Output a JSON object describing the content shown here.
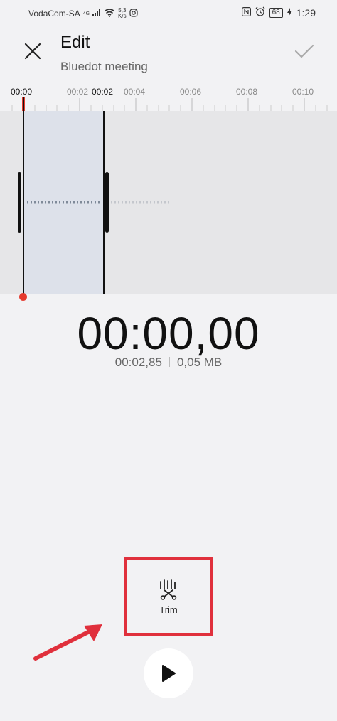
{
  "status_bar": {
    "carrier": "VodaCom-SA",
    "network": "4G",
    "speed_value": "5,3",
    "speed_unit": "K/s",
    "battery": "68",
    "time": "1:29"
  },
  "header": {
    "title": "Edit",
    "subtitle": "Bluedot meeting"
  },
  "ruler": {
    "labels": [
      "00:00",
      "00:02",
      "00:02",
      "00:04",
      "00:06",
      "00:08",
      "00:10"
    ]
  },
  "playback": {
    "current_time": "00:00,00",
    "duration": "00:02,85",
    "file_size": "0,05 MB"
  },
  "actions": {
    "trim_label": "Trim"
  },
  "colors": {
    "accent_red": "#e0303c",
    "playhead_red": "#e53a2e",
    "selection": "#dde1ea",
    "background": "#f2f2f4"
  },
  "icons": {
    "close": "close-icon",
    "confirm": "check-icon",
    "trim": "trim-scissors-icon",
    "play": "play-icon"
  }
}
